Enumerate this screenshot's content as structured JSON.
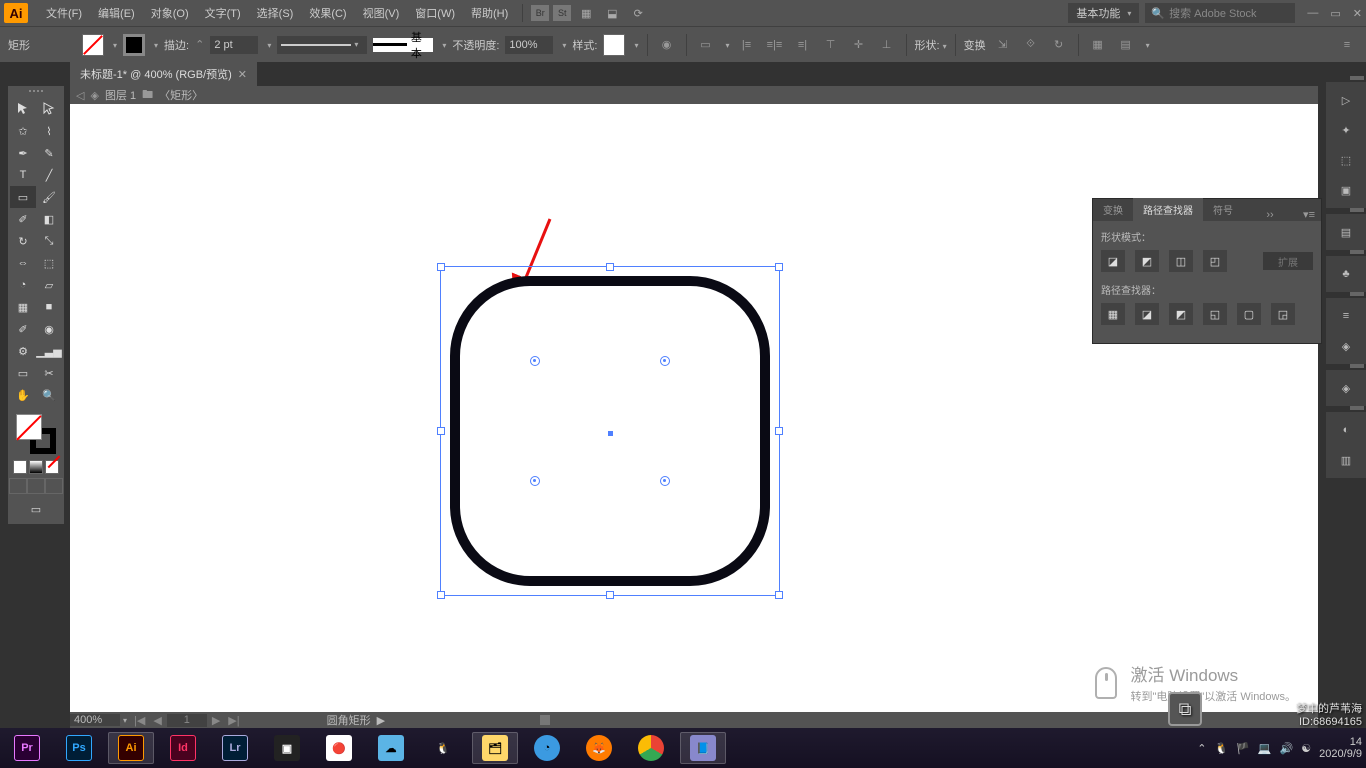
{
  "menubar": {
    "items": [
      "文件(F)",
      "编辑(E)",
      "对象(O)",
      "文字(T)",
      "选择(S)",
      "效果(C)",
      "视图(V)",
      "窗口(W)",
      "帮助(H)"
    ],
    "workspace": "基本功能",
    "search_placeholder": "搜索 Adobe Stock"
  },
  "options": {
    "selection": "矩形",
    "stroke_label": "描边:",
    "stroke_weight": "2 pt",
    "stroke_profile": "基本",
    "opacity_label": "不透明度:",
    "opacity_value": "100%",
    "style_label": "样式:",
    "shape_label": "形状:",
    "transform_label": "变换"
  },
  "document": {
    "tab_title": "未标题-1* @ 400% (RGB/预览)",
    "breadcrumb_layer": "图层 1",
    "breadcrumb_object": "〈矩形〉"
  },
  "panel": {
    "tabs": [
      "变换",
      "路径查找器",
      "符号"
    ],
    "active_tab": 1,
    "shape_modes_label": "形状模式：",
    "pathfinder_label": "路径查找器：",
    "expand_label": "扩展"
  },
  "status": {
    "zoom": "400%",
    "page": "1",
    "tool": "圆角矩形"
  },
  "watermark": {
    "title": "激活 Windows",
    "subtitle": "转到\"电脑设置\"以激活 Windows。"
  },
  "attribution": {
    "line1": "梦中的芦苇海",
    "line2": "ID:68694165"
  },
  "taskbar": {
    "time": "14",
    "date": "2020/9/9"
  },
  "tools": [
    "selection",
    "direct-selection",
    "magic-wand",
    "lasso",
    "pen",
    "curvature",
    "type",
    "line",
    "rectangle",
    "paintbrush",
    "shaper",
    "eraser",
    "rotate",
    "scale",
    "width",
    "free-transform",
    "shape-builder",
    "perspective",
    "mesh",
    "gradient",
    "eyedropper",
    "blend",
    "symbol-sprayer",
    "column-graph",
    "artboard",
    "slice",
    "hand",
    "zoom"
  ],
  "dock_groups": [
    [
      "properties-icon",
      "libraries-icon",
      "layers-icon",
      "artboards-icon"
    ],
    [
      "brushes-icon"
    ],
    [
      "swatches-icon"
    ],
    [
      "stroke-icon",
      "gradient-icon"
    ],
    [
      "layers-panel-icon"
    ],
    [
      "appearance-icon",
      "graphic-styles-icon"
    ]
  ]
}
